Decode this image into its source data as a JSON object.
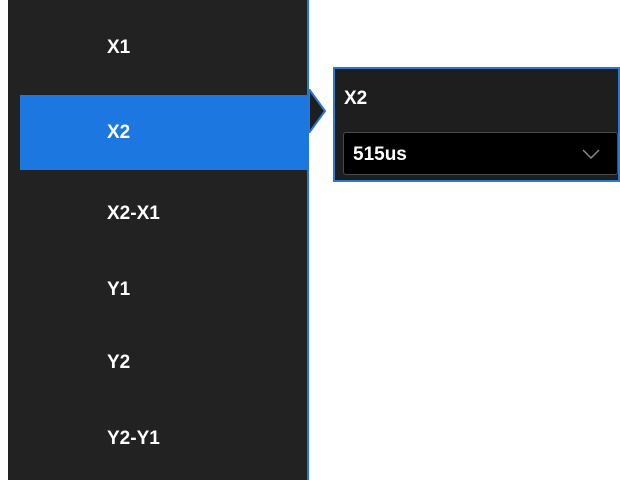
{
  "menu": {
    "items": [
      {
        "label": "X1",
        "selected": false
      },
      {
        "label": "X2",
        "selected": true
      },
      {
        "label": "X2-X1",
        "selected": false
      },
      {
        "label": "Y1",
        "selected": false
      },
      {
        "label": "Y2",
        "selected": false
      },
      {
        "label": "Y2-Y1",
        "selected": false
      }
    ]
  },
  "popup": {
    "title": "X2",
    "value": "515us",
    "dropdown_icon": "chevron-down-icon"
  },
  "colors": {
    "accent": "#1c78e0",
    "panel_bg": "#222222",
    "popup_bg": "#1e1e1e",
    "field_bg": "#000000",
    "text": "#ffffff"
  }
}
